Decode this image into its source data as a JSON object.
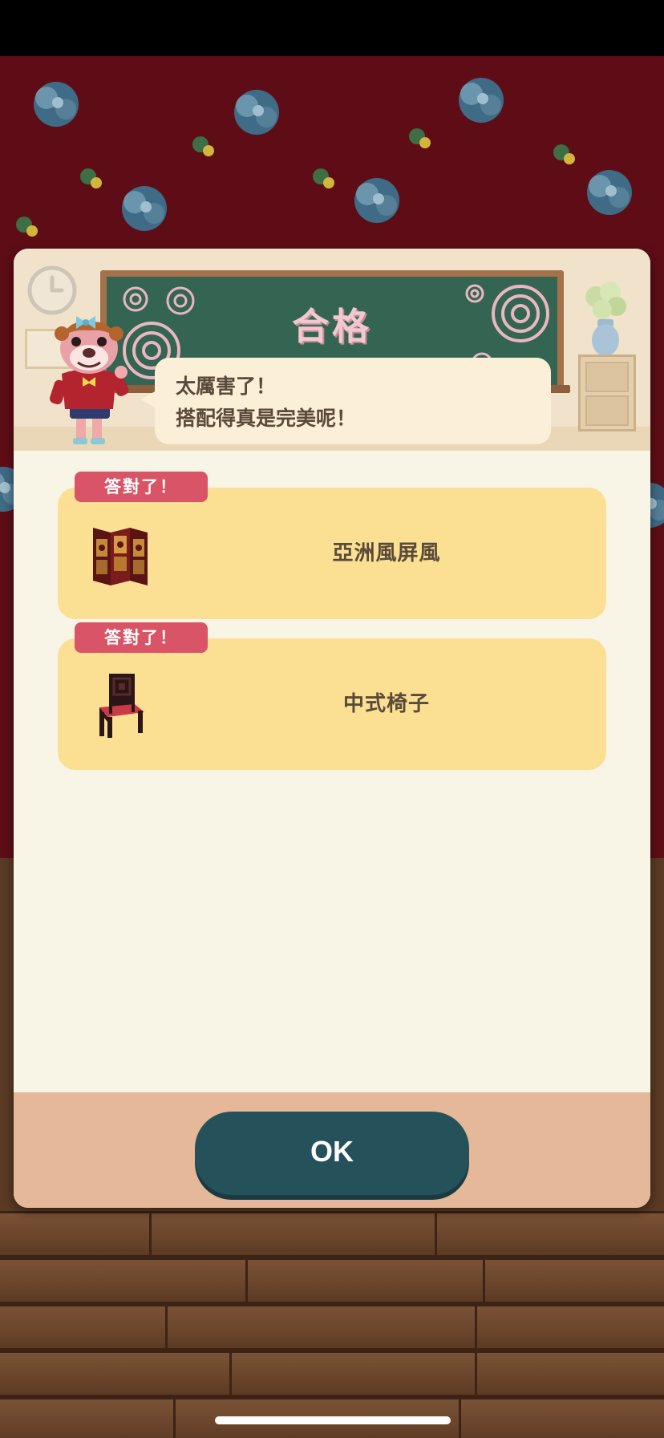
{
  "dialog": {
    "title": "合格",
    "message_line1": "太厲害了！",
    "message_line2": "搭配得真是完美呢！"
  },
  "results": [
    {
      "badge": "答對了！",
      "item_name": "亞洲風屏風",
      "icon": "folding-screen-icon"
    },
    {
      "badge": "答對了！",
      "item_name": "中式椅子",
      "icon": "chinese-chair-icon"
    }
  ],
  "footer": {
    "ok_label": "OK"
  },
  "colors": {
    "badge": "#d85466",
    "card": "#fbdf93",
    "ok_button": "#25515a",
    "chalkboard": "#346452",
    "footer": "#e4b898"
  }
}
